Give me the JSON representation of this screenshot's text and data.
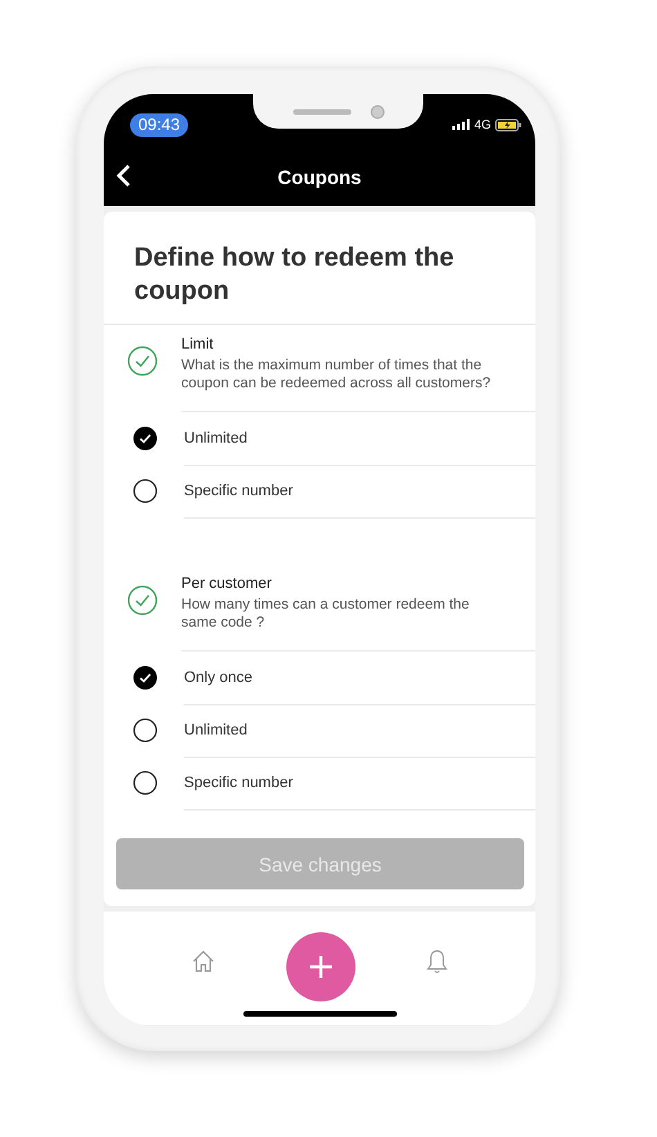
{
  "status_bar": {
    "time": "09:43",
    "network": "4G"
  },
  "header": {
    "title": "Coupons"
  },
  "page": {
    "title": "Define how to redeem the coupon"
  },
  "sections": [
    {
      "title": "Limit",
      "description": "What is the maximum number of times that the coupon can be redeemed across all customers?",
      "done": true,
      "options": [
        {
          "label": "Unlimited",
          "selected": true
        },
        {
          "label": "Specific number",
          "selected": false
        }
      ]
    },
    {
      "title": "Per customer",
      "description": "How many times can a customer redeem the same code ?",
      "done": true,
      "options": [
        {
          "label": "Only once",
          "selected": true
        },
        {
          "label": "Unlimited",
          "selected": false
        },
        {
          "label": "Specific number",
          "selected": false
        }
      ]
    }
  ],
  "save_button": {
    "label": "Save changes",
    "disabled": true
  }
}
